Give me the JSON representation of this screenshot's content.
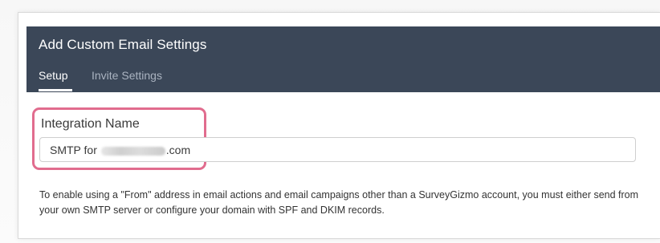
{
  "modal": {
    "title": "Add Custom Email Settings",
    "tabs": [
      {
        "label": "Setup",
        "active": true
      },
      {
        "label": "Invite Settings",
        "active": false
      }
    ]
  },
  "form": {
    "integration_name": {
      "label": "Integration Name",
      "value_prefix": "SMTP for ",
      "value_suffix": ".com",
      "value_redacted": true
    },
    "help_text": "To enable using a \"From\" address in email actions and email campaigns other than a SurveyGizmo account, you must either send from your own SMTP server or configure your domain with SPF and DKIM records."
  },
  "colors": {
    "header_bg": "#3b4758",
    "active_tab": "#ffffff",
    "inactive_tab": "#aab3c0",
    "highlight": "#e16c8e"
  }
}
